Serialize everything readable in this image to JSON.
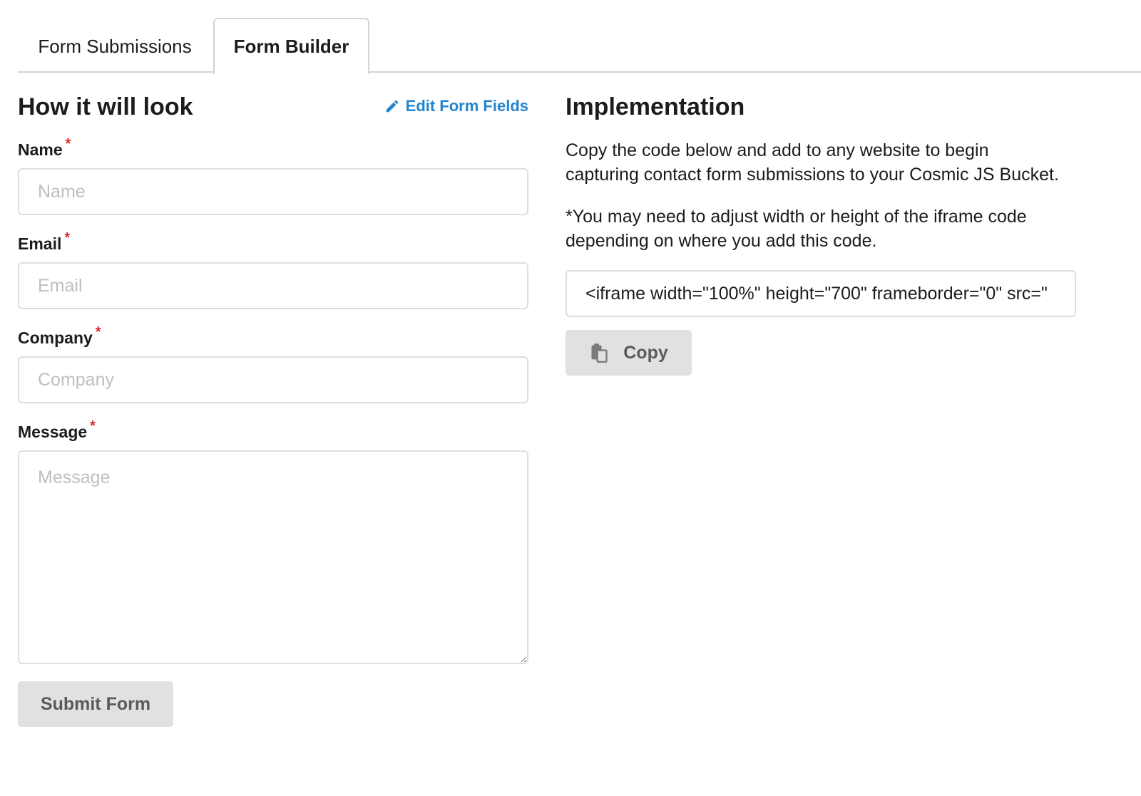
{
  "tabs": [
    {
      "label": "Form Submissions",
      "active": false
    },
    {
      "label": "Form Builder",
      "active": true
    }
  ],
  "preview": {
    "heading": "How it will look",
    "edit_link": "Edit Form Fields",
    "fields": {
      "name": {
        "label": "Name",
        "required": "*",
        "placeholder": "Name",
        "value": ""
      },
      "email": {
        "label": "Email",
        "required": "*",
        "placeholder": "Email",
        "value": ""
      },
      "company": {
        "label": "Company",
        "required": "*",
        "placeholder": "Company",
        "value": ""
      },
      "message": {
        "label": "Message",
        "required": "*",
        "placeholder": "Message",
        "value": ""
      }
    },
    "submit_label": "Submit Form"
  },
  "implementation": {
    "heading": "Implementation",
    "paragraph1": "Copy the code below and add to any website to begin capturing contact form submissions to your Cosmic JS Bucket.",
    "paragraph2": "*You may need to adjust width or height of the iframe code depending on where you add this code.",
    "code": "<iframe width=\"100%\" height=\"700\" frameborder=\"0\" src=\"",
    "copy_label": "Copy"
  },
  "colors": {
    "link": "#2185d0",
    "required": "#db2828",
    "button_bg": "#e0e1e2"
  },
  "icons": {
    "edit": "pencil-icon",
    "copy": "paste-icon"
  }
}
